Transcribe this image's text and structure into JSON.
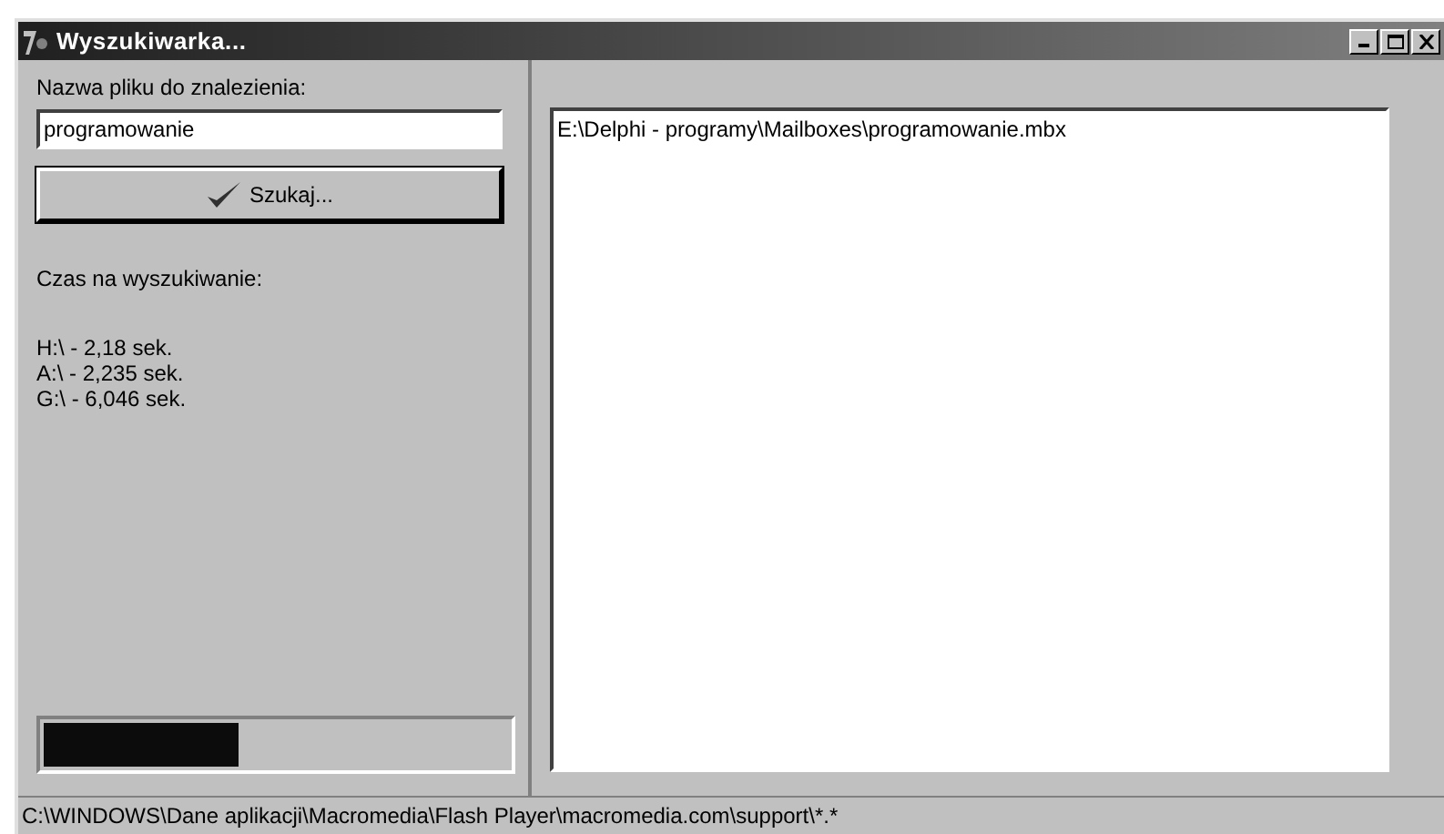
{
  "window": {
    "title": "Wyszukiwarka..."
  },
  "search": {
    "label": "Nazwa pliku do znalezienia:",
    "value": "programowanie"
  },
  "search_button": {
    "label": "Szukaj..."
  },
  "time_label": "Czas na wyszukiwanie:",
  "times": [
    "H:\\ - 2,18 sek.",
    "A:\\ - 2,235 sek.",
    "G:\\ - 6,046 sek."
  ],
  "progress": {
    "level": 0.42
  },
  "results": [
    "E:\\Delphi - programy\\Mailboxes\\programowanie.mbx"
  ],
  "status_bar": "C:\\WINDOWS\\Dane aplikacji\\Macromedia\\Flash Player\\macromedia.com\\support\\*.*"
}
